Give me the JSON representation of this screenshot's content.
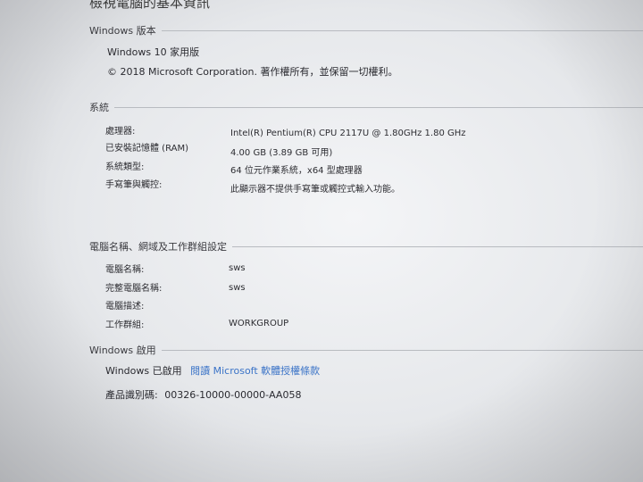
{
  "page_title": "檢視電腦的基本資訊",
  "windows_edition": {
    "heading": "Windows 版本",
    "edition": "Windows 10 家用版",
    "copyright": "© 2018 Microsoft Corporation. 著作權所有，並保留一切權利。"
  },
  "system": {
    "heading": "系統",
    "rows": [
      {
        "label": "處理器:",
        "value": "Intel(R) Pentium(R) CPU 2117U @ 1.80GHz   1.80 GHz"
      },
      {
        "label": "已安裝記憶體 (RAM)",
        "value": "4.00 GB (3.89 GB 可用)"
      },
      {
        "label": "系統類型:",
        "value": "64 位元作業系統，x64 型處理器"
      },
      {
        "label": "手寫筆與觸控:",
        "value": "此顯示器不提供手寫筆或觸控式輸入功能。"
      }
    ]
  },
  "computer_name": {
    "heading": "電腦名稱、網域及工作群組設定",
    "rows": [
      {
        "label": "電腦名稱:",
        "value": "sws"
      },
      {
        "label": "完整電腦名稱:",
        "value": "sws"
      },
      {
        "label": "電腦描述:",
        "value": ""
      },
      {
        "label": "工作群組:",
        "value": "WORKGROUP"
      }
    ]
  },
  "activation": {
    "heading": "Windows 啟用",
    "status": "Windows 已啟用",
    "license_link": "閱讀 Microsoft 軟體授權條款",
    "product_id_label": "產品識別碼:",
    "product_id": "00326-10000-00000-AA058"
  },
  "colors": {
    "link": "#3a73c7",
    "text": "#2a2a30",
    "rule": "#b8bbc0"
  }
}
